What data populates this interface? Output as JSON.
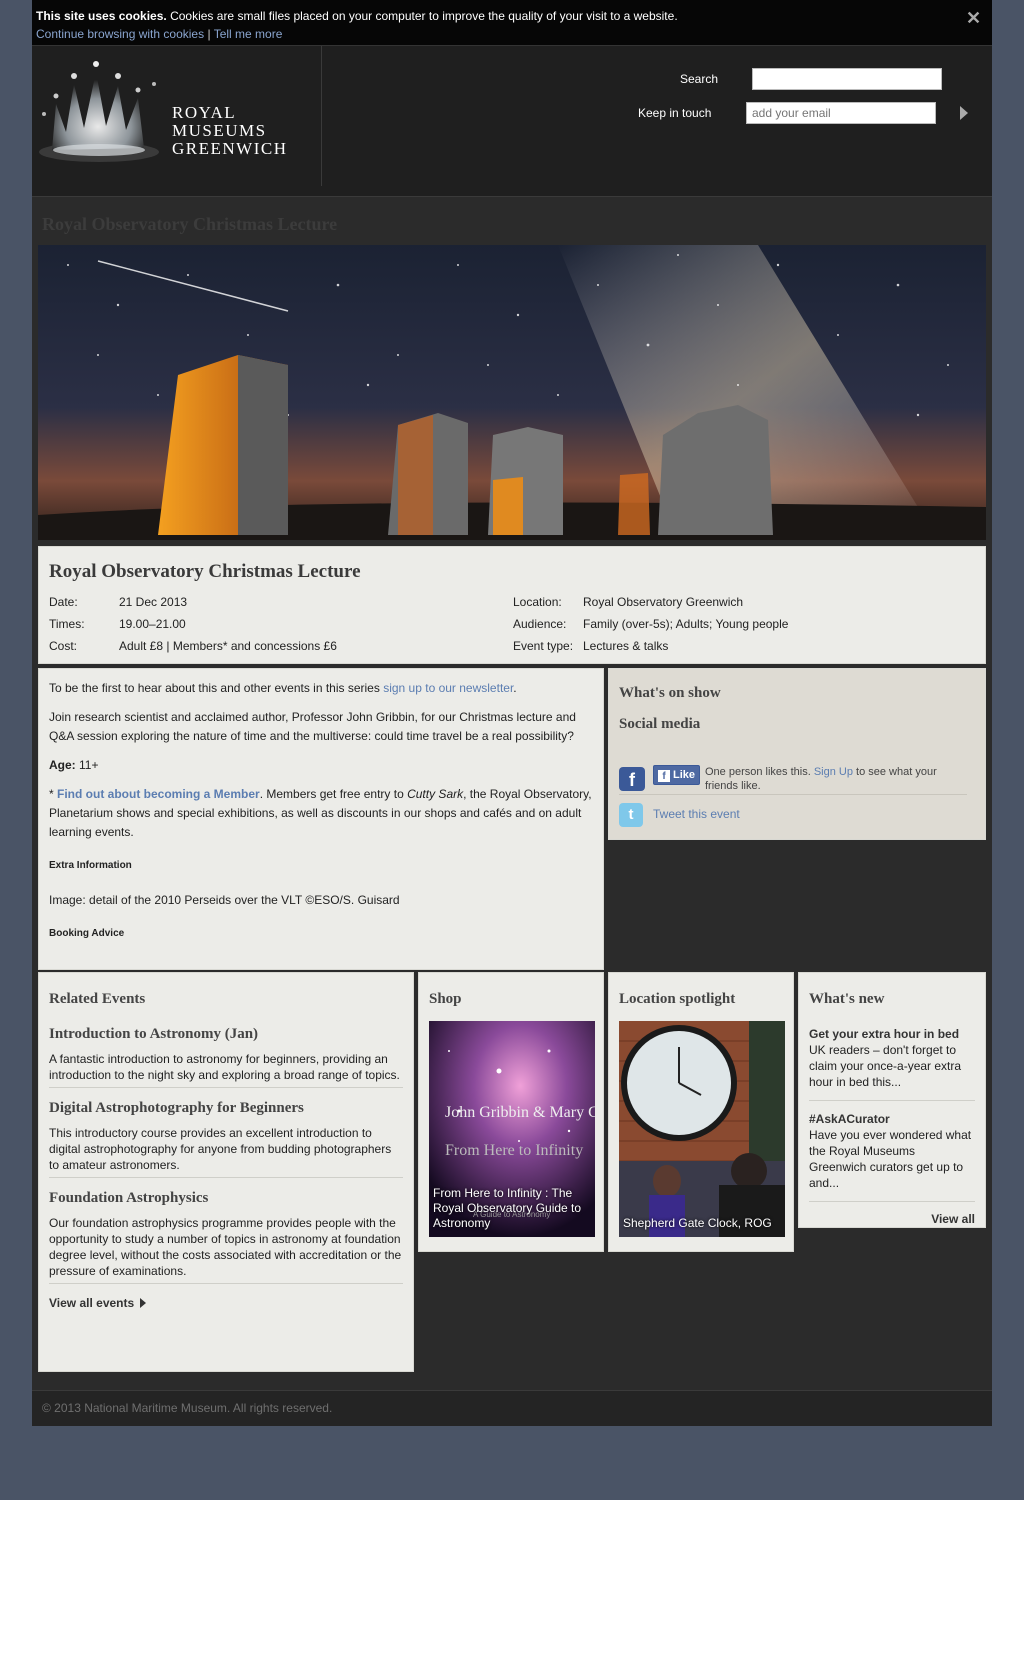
{
  "cookie": {
    "heading": "This site uses cookies.",
    "text": "Cookies are small files placed on your computer to improve the quality of your visit to a website.",
    "continue_link": "Continue browsing with cookies",
    "separator": "|",
    "more_link": "Tell me more",
    "close_icon": "close-icon"
  },
  "header": {
    "logo_lines": [
      "ROYAL",
      "MUSEUMS",
      "GREENWICH"
    ],
    "search_label": "Search",
    "search_value": "",
    "keep_in_touch_label": "Keep in touch",
    "email_placeholder": "add your email"
  },
  "page": {
    "ghost_title": "Royal Observatory Christmas Lecture"
  },
  "event": {
    "title": "Royal Observatory Christmas Lecture",
    "date_label": "Date:",
    "date": "21 Dec 2013",
    "times_label": "Times:",
    "times": "19.00–21.00",
    "cost_label": "Cost:",
    "cost": "Adult £8 | Members* and concessions £6",
    "location_label": "Location:",
    "location": "Royal Observatory Greenwich",
    "audience_label": "Audience:",
    "audience": "Family (over-5s); Adults; Young people",
    "type_label": "Event type:",
    "type": "Lectures & talks"
  },
  "description": {
    "newsletter_text": "To be the first to hear about this and other events in this series ",
    "newsletter_link": "sign up to our newsletter",
    "newsletter_end": ".",
    "intro": "Join research scientist and acclaimed author, Professor John Gribbin, for our Christmas lecture and Q&A session exploring the nature of time and the multiverse: could time travel be a real possibility?",
    "age_label": "Age:",
    "age_value": " 11+",
    "member_star": "* ",
    "member_link": "Find out about becoming a Member",
    "member_text_1": ". Members get free entry to ",
    "member_italic": "Cutty Sark",
    "member_text_2": ", the Royal Observatory, Planetarium shows and special exhibitions, as well as discounts in our shops and cafés and on adult learning events.",
    "extra_heading": "Extra Information",
    "image_credit": "Image: detail of the 2010 Perseids over the VLT ©ESO/S. Guisard",
    "booking_heading": "Booking Advice"
  },
  "side": {
    "whats_on_show": "What's on show",
    "social_media": "Social media",
    "fb_like_label": "Like",
    "fb_text_1": "One person likes this. ",
    "fb_signup": "Sign Up",
    "fb_text_2": " to see what your friends like.",
    "tweet_link": "Tweet this event"
  },
  "related": {
    "heading": "Related Events",
    "items": [
      {
        "title": "Introduction to Astronomy (Jan)",
        "text": "A fantastic introduction to astronomy for beginners, providing an introduction to the night sky and exploring a broad range of topics."
      },
      {
        "title": "Digital Astrophotography for Beginners",
        "text": "This introductory course provides an excellent introduction to digital astrophotography for anyone from budding photographers to amateur astronomers."
      },
      {
        "title": "Foundation Astrophysics",
        "text": "Our foundation astrophysics programme provides people with the opportunity to study a number of topics in astronomy at foundation degree level, without the costs associated with accreditation or the pressure of examinations."
      }
    ],
    "view_all": "View all events"
  },
  "shop": {
    "heading": "Shop",
    "book_authors": "John Gribbin & Mary Gribbin",
    "book_title_overlay": "From Here to Infinity",
    "book_subtitle_overlay": "A Guide to Astronomy",
    "caption": "From Here to Infinity : The Royal Observatory Guide to Astronomy"
  },
  "location_spotlight": {
    "heading": "Location spotlight",
    "caption": "Shepherd Gate Clock, ROG"
  },
  "whats_new": {
    "heading": "What's new",
    "items": [
      {
        "title": "Get your extra hour in bed",
        "text": "UK readers – don't forget to claim your once-a-year extra hour in bed this..."
      },
      {
        "title": "#AskACurator",
        "text": "Have you ever wondered what the Royal Museums Greenwich curators get up to and..."
      }
    ],
    "view_all": "View all"
  },
  "footer": {
    "copyright": "© 2013 National Maritime Museum. All rights reserved."
  },
  "colors": {
    "page_bg": "#4a5466",
    "wrapper": "#2b2b2b",
    "panel": "#ecece8",
    "link": "#5b7db1"
  }
}
